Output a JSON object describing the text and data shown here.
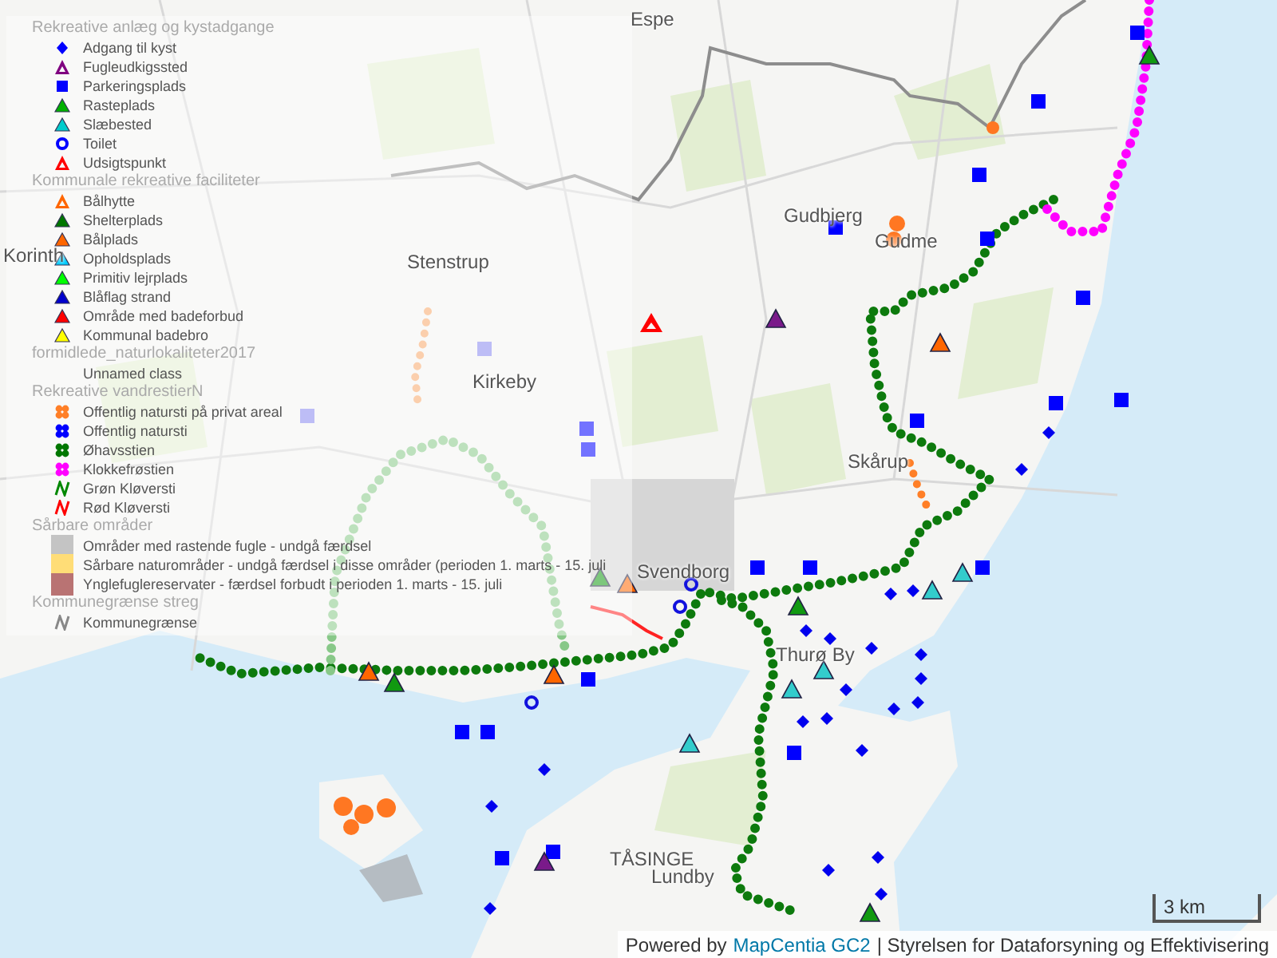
{
  "map": {
    "places": [
      {
        "name": "Espe"
      },
      {
        "name": "Korinth"
      },
      {
        "name": "Stenstrup"
      },
      {
        "name": "Kirkeby"
      },
      {
        "name": "Gudbjerg"
      },
      {
        "name": "Gudme"
      },
      {
        "name": "Skårup"
      },
      {
        "name": "Svendborg"
      },
      {
        "name": "Thurø By"
      },
      {
        "name": "TÅSINGE"
      },
      {
        "name": "Lundby"
      }
    ]
  },
  "legend": {
    "groups": [
      {
        "title": "Rekreative anlæg og kystadgange",
        "items": [
          {
            "label": "Adgang til kyst",
            "kind": "diamond",
            "color": "#0000ff"
          },
          {
            "label": "Fugleudkigssted",
            "kind": "hollow-triangle",
            "color": "#800080"
          },
          {
            "label": "Parkeringsplads",
            "kind": "square",
            "color": "#0000ff"
          },
          {
            "label": "Rasteplads",
            "kind": "triangle",
            "color": "#00b000"
          },
          {
            "label": "Slæbested",
            "kind": "triangle",
            "color": "#00cccc"
          },
          {
            "label": "Toilet",
            "kind": "ring",
            "color": "#0000ff"
          },
          {
            "label": "Udsigtspunkt",
            "kind": "hollow-triangle",
            "color": "#ff0000"
          }
        ]
      },
      {
        "title": "Kommunale rekreative faciliteter",
        "items": [
          {
            "label": "Bålhytte",
            "kind": "hollow-triangle",
            "color": "#ff6600"
          },
          {
            "label": "Shelterplads",
            "kind": "triangle",
            "color": "#007700"
          },
          {
            "label": "Bålplads",
            "kind": "triangle",
            "color": "#ff6600"
          },
          {
            "label": "Opholdsplads",
            "kind": "triangle",
            "color": "#00ccff"
          },
          {
            "label": "Primitiv lejrplads",
            "kind": "triangle",
            "color": "#00ff00"
          },
          {
            "label": "Blåflag strand",
            "kind": "triangle",
            "color": "#0000cc"
          },
          {
            "label": "Område med badeforbud",
            "kind": "triangle",
            "color": "#ff0000"
          },
          {
            "label": "Kommunal badebro",
            "kind": "triangle",
            "color": "#ffff00"
          }
        ]
      },
      {
        "title": "formidlede_naturlokaliteter2017",
        "items": [
          {
            "label": "Unnamed class",
            "kind": "none"
          }
        ]
      },
      {
        "title": "Rekreative vandrestierN",
        "items": [
          {
            "label": "Offentlig natursti på privat areal",
            "kind": "flower",
            "color": "#ff7f27"
          },
          {
            "label": "Offentlig natursti",
            "kind": "flower",
            "color": "#0000ff"
          },
          {
            "label": "Øhavsstien",
            "kind": "flower",
            "color": "#007700"
          },
          {
            "label": "Klokkefrøstien",
            "kind": "flower",
            "color": "#ff00ff"
          },
          {
            "label": "Grøn Kløversti",
            "kind": "zigzag",
            "color": "#008800"
          },
          {
            "label": "Rød Kløversti",
            "kind": "zigzag",
            "color": "#ff0000"
          }
        ]
      },
      {
        "title": "Sårbare områder",
        "items": [
          {
            "label": "Områder med rastende fugle - undgå færdsel",
            "kind": "swatch",
            "color": "#c4c4c4"
          },
          {
            "label": "Sårbare naturområder - undgå færdsel i disse områder (perioden 1. marts - 15. juli",
            "kind": "swatch",
            "color": "#ffdd77"
          },
          {
            "label": "Ynglefuglereservater - færdsel forbudt i perioden 1. marts - 15. juli",
            "kind": "swatch",
            "color": "#b97373"
          }
        ]
      },
      {
        "title": "Kommunegrænse streg",
        "items": [
          {
            "label": "Kommunegrænse",
            "kind": "zigzag",
            "color": "#888888"
          }
        ]
      }
    ]
  },
  "scale": {
    "label": "3 km"
  },
  "attribution": {
    "prefix": "Powered by",
    "link": "MapCentia GC2",
    "suffix": "| Styrelsen for Dataforsyning og Effektivisering"
  }
}
